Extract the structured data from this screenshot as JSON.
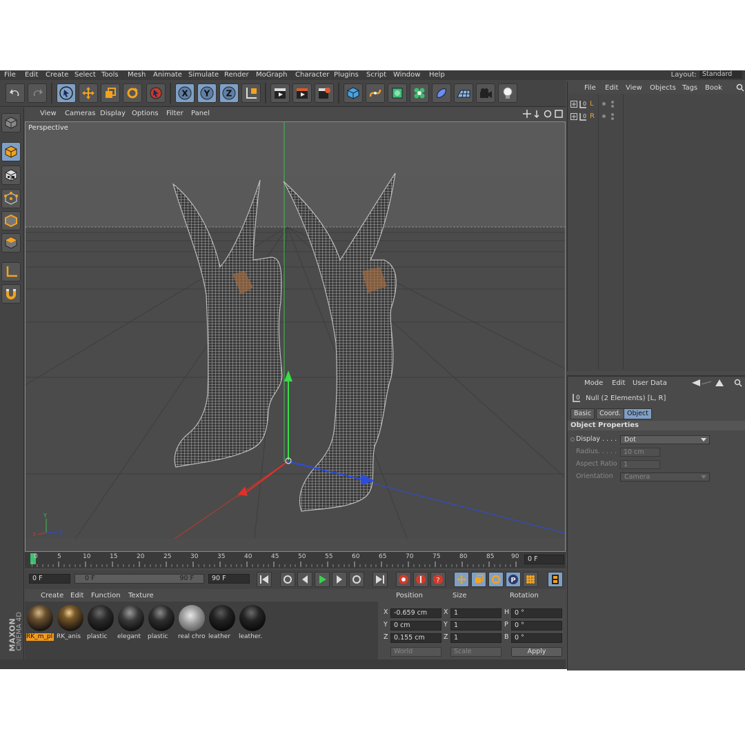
{
  "menubar": {
    "items": [
      "File",
      "Edit",
      "Create",
      "Select",
      "Tools",
      "Mesh",
      "Animate",
      "Simulate",
      "Render",
      "MoGraph",
      "Character",
      "Plugins",
      "Script",
      "Window",
      "Help"
    ],
    "layout_label": "Layout:",
    "layout_value": "Standard"
  },
  "viewport": {
    "menu": [
      "View",
      "Cameras",
      "Display",
      "Options",
      "Filter",
      "Panel"
    ],
    "camera_label": "Perspective"
  },
  "timeline": {
    "ruler": [
      "0",
      "5",
      "10",
      "15",
      "20",
      "25",
      "30",
      "35",
      "40",
      "45",
      "50",
      "55",
      "60",
      "65",
      "70",
      "75",
      "80",
      "85",
      "90"
    ],
    "current_frame": "0 F",
    "start_frame": "0 F",
    "range_start": "0 F",
    "range_end": "90 F",
    "end_frame": "90 F"
  },
  "materials": {
    "menu": [
      "Create",
      "Edit",
      "Function",
      "Texture"
    ],
    "items": [
      {
        "name": "RK_m_pl",
        "selected": true
      },
      {
        "name": "RK_anis",
        "selected": false
      },
      {
        "name": "plastic",
        "selected": false
      },
      {
        "name": "elegant",
        "selected": false
      },
      {
        "name": "plastic",
        "selected": false
      },
      {
        "name": "real chro",
        "selected": false
      },
      {
        "name": "leather",
        "selected": false
      },
      {
        "name": "leather.",
        "selected": false
      }
    ]
  },
  "coordinates": {
    "headers": {
      "position": "Position",
      "size": "Size",
      "rotation": "Rotation"
    },
    "rows": [
      {
        "axis": "X",
        "pos": "-0.659 cm",
        "size_axis": "X",
        "size": "1",
        "rot_axis": "H",
        "rot": "0 °"
      },
      {
        "axis": "Y",
        "pos": "0 cm",
        "size_axis": "Y",
        "size": "1",
        "rot_axis": "P",
        "rot": "0 °"
      },
      {
        "axis": "Z",
        "pos": "0.155 cm",
        "size_axis": "Z",
        "size": "1",
        "rot_axis": "B",
        "rot": "0 °"
      }
    ],
    "mode_world": "World",
    "mode_scale": "Scale",
    "apply": "Apply"
  },
  "brand": {
    "company": "MAXON",
    "product": "CINEMA 4D"
  },
  "object_manager": {
    "menu": [
      "File",
      "Edit",
      "View",
      "Objects",
      "Tags",
      "Book"
    ],
    "objects": [
      {
        "name": "L"
      },
      {
        "name": "R"
      }
    ]
  },
  "attributes": {
    "menu": [
      "Mode",
      "Edit",
      "User Data"
    ],
    "object_title": "Null (2 Elements) [L, R]",
    "tabs": [
      "Basic",
      "Coord.",
      "Object"
    ],
    "section": "Object Properties",
    "display_label": "Display . . . .",
    "display_value": "Dot",
    "radius_label": "Radius. . . . .",
    "radius_value": "10 cm",
    "aspect_label": "Aspect Ratio",
    "aspect_value": "1",
    "orientation_label": "Orientation",
    "orientation_value": "Camera"
  },
  "colors": {
    "accent_blue": "#7fa0c6",
    "selection_orange": "#f29a1f",
    "axis_x": "#d23a2a",
    "axis_y": "#2ec43a",
    "axis_z": "#2a4de0"
  }
}
